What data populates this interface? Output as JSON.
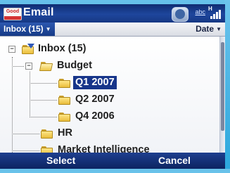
{
  "titlebar": {
    "brand_icon_text": "Good",
    "title": "Email",
    "status": {
      "notification_icon": "notification-bubble-icon",
      "input_mode": "abc",
      "signal_icon": "signal-strength-icon",
      "network_type": "H"
    }
  },
  "toolbar": {
    "folder_filter": "Inbox (15)",
    "sort_by": "Date"
  },
  "tree": {
    "root": {
      "label": "Inbox (15)",
      "expanded": true,
      "icon": "inbox-folder-icon"
    },
    "items": [
      {
        "label": "Budget",
        "expanded": true,
        "icon": "folder-open-icon"
      },
      {
        "label": "Q1 2007",
        "selected": true,
        "icon": "folder-icon"
      },
      {
        "label": "Q2 2007",
        "icon": "folder-icon"
      },
      {
        "label": "Q4 2006",
        "icon": "folder-icon"
      },
      {
        "label": "HR",
        "icon": "folder-icon"
      },
      {
        "label": "Market Intelligence",
        "icon": "folder-icon"
      }
    ]
  },
  "softkeys": {
    "left": "Select",
    "right": "Cancel"
  },
  "colors": {
    "titlebar": "#1e469c",
    "selection": "#17358a",
    "bezel": "#5fb8e4"
  }
}
